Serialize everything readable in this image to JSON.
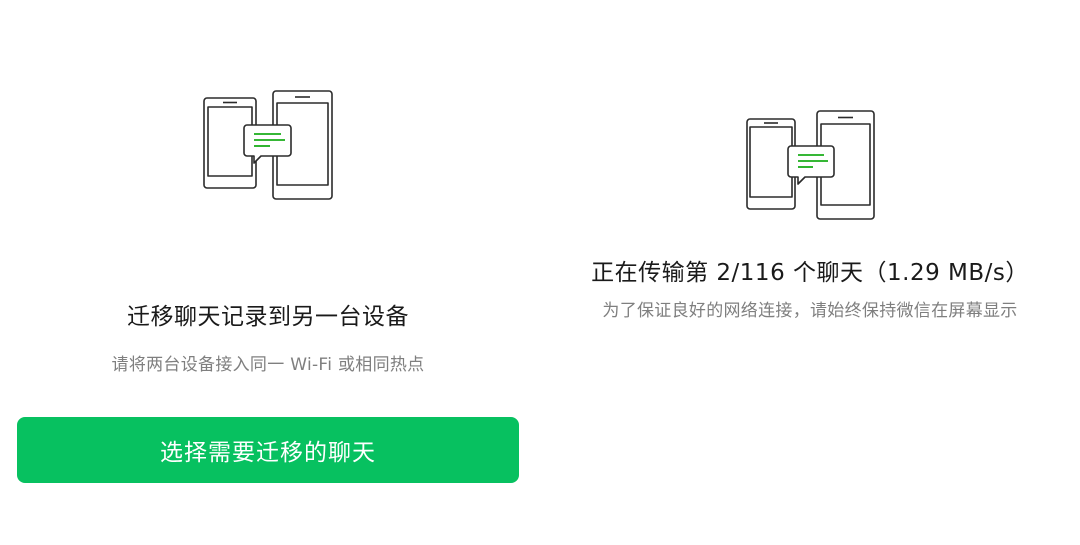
{
  "migrate": {
    "title": "迁移聊天记录到另一台设备",
    "subtitle": "请将两台设备接入同一 Wi-Fi 或相同热点",
    "button_label": "选择需要迁移的聊天",
    "illustration_icon": "phone-transfer-icon"
  },
  "transfer": {
    "status": "正在传输第 2/116 个聊天（1.29 MB/s）",
    "hint": "为了保证良好的网络连接，请始终保持微信在屏幕显示",
    "illustration_icon": "phone-transfer-icon"
  },
  "colors": {
    "accent": "#07c160",
    "icon_stroke": "#2b2b2b",
    "icon_accent": "#1aad19",
    "secondary_text": "#7f7f7f"
  }
}
